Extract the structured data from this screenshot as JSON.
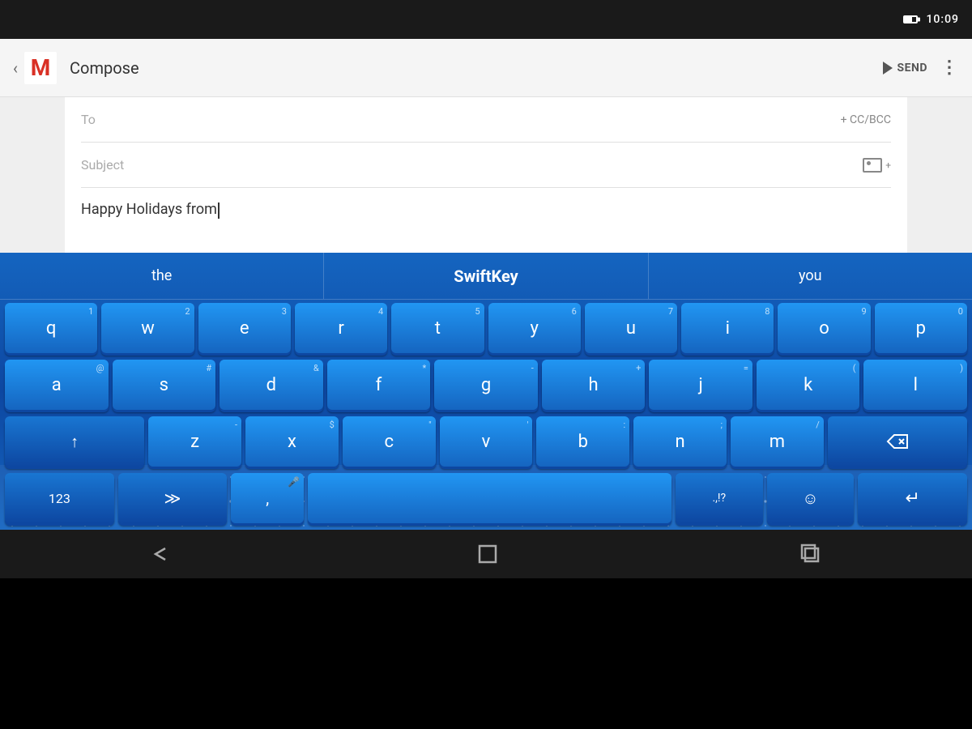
{
  "statusBar": {
    "time": "10:09",
    "batteryLevel": 60
  },
  "toolbar": {
    "backLabel": "‹",
    "title": "Compose",
    "sendLabel": "SEND",
    "moreLabel": "⋮"
  },
  "compose": {
    "toLabel": "To",
    "toPlaceholder": "",
    "ccBccLabel": "+ CC/BCC",
    "subjectLabel": "Subject",
    "subjectPlaceholder": "",
    "bodyText": "Happy Holidays from"
  },
  "suggestions": {
    "left": "the",
    "center": "SwiftKey",
    "right": "you"
  },
  "keyboard": {
    "row1": [
      {
        "key": "q",
        "super": "1"
      },
      {
        "key": "w",
        "super": "2"
      },
      {
        "key": "e",
        "super": "3"
      },
      {
        "key": "r",
        "super": "4"
      },
      {
        "key": "t",
        "super": "5"
      },
      {
        "key": "y",
        "super": "6"
      },
      {
        "key": "u",
        "super": "7"
      },
      {
        "key": "i",
        "super": "8"
      },
      {
        "key": "o",
        "super": "9"
      },
      {
        "key": "p",
        "super": "0"
      }
    ],
    "row2": [
      {
        "key": "a",
        "super": "@"
      },
      {
        "key": "s",
        "super": "#"
      },
      {
        "key": "d",
        "super": "&"
      },
      {
        "key": "f",
        "super": "*"
      },
      {
        "key": "g",
        "super": "-"
      },
      {
        "key": "h",
        "super": "+"
      },
      {
        "key": "j",
        "super": ""
      },
      {
        "key": "k",
        "super": "("
      },
      {
        "key": "l",
        "super": ")"
      }
    ],
    "row3": [
      {
        "key": "z",
        "super": ""
      },
      {
        "key": "x",
        "super": "$"
      },
      {
        "key": "c",
        "super": "\""
      },
      {
        "key": "v",
        "super": "'"
      },
      {
        "key": "b",
        "super": ":"
      },
      {
        "key": "n",
        "super": ";"
      },
      {
        "key": "m",
        "super": "/"
      }
    ],
    "row4": {
      "numsLabel": "123",
      "swiftkeyLabel": "≫",
      "commaLabel": ",",
      "micLabel": "🎤",
      "spaceLabel": "",
      "periodLabel": ".,!?",
      "emojiLabel": "☺",
      "enterLabel": "↵"
    }
  },
  "navBar": {
    "backTitle": "back",
    "homeTitle": "home",
    "recentTitle": "recent"
  }
}
